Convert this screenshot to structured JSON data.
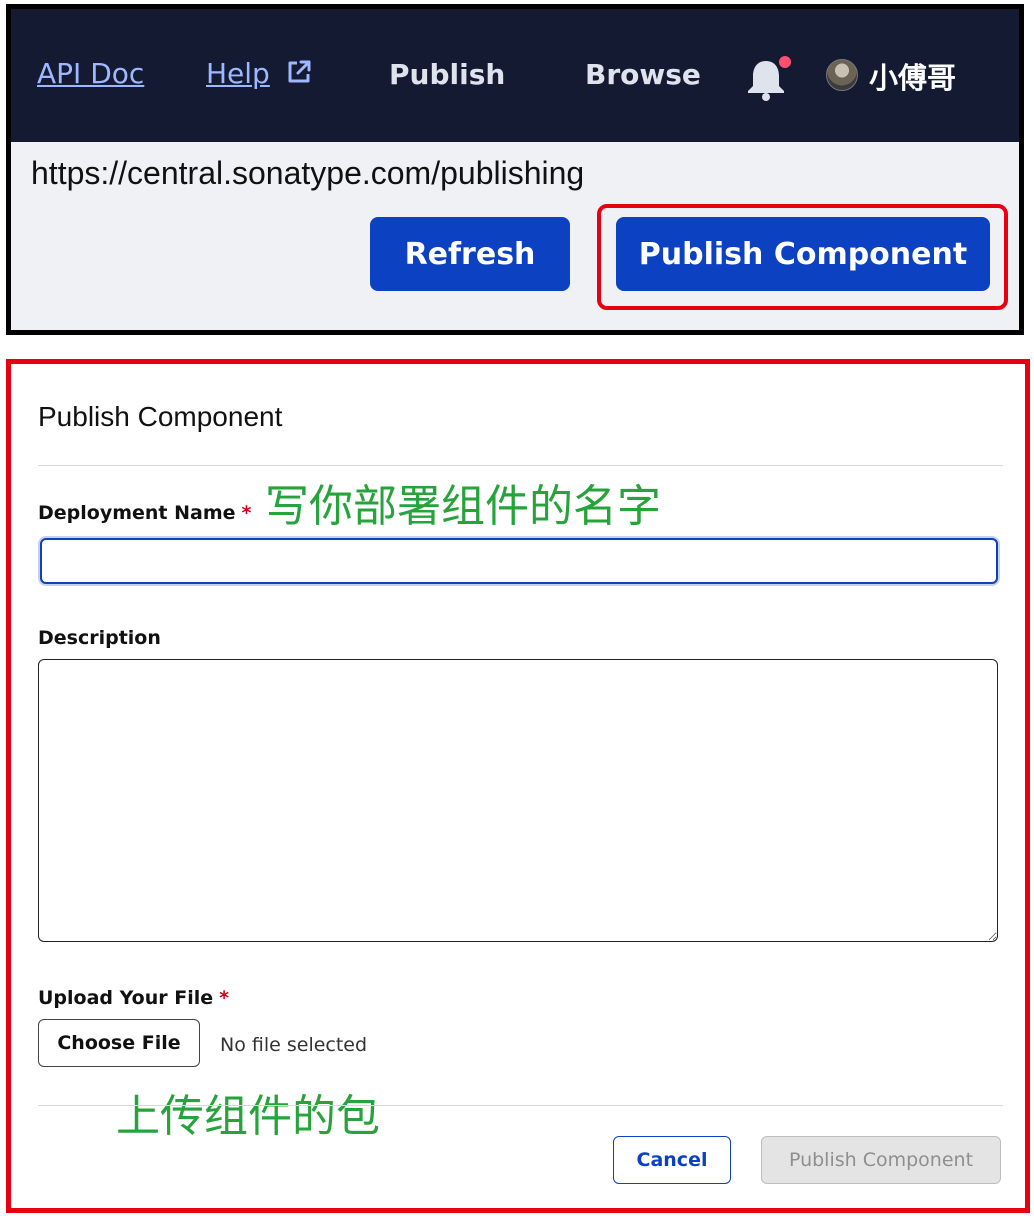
{
  "header": {
    "api_doc": "API Doc",
    "help": "Help",
    "publish": "Publish",
    "browse": "Browse",
    "username": "小傅哥",
    "has_notification": true
  },
  "toolbar": {
    "url": "https://central.sonatype.com/publishing",
    "refresh_label": "Refresh",
    "publish_component_label": "Publish Component"
  },
  "modal": {
    "title": "Publish Component",
    "deployment_name_label": "Deployment Name",
    "deployment_name_value": "",
    "description_label": "Description",
    "description_value": "",
    "upload_label": "Upload Your File",
    "required_mark": "*",
    "choose_file_label": "Choose File",
    "file_status": "No file selected",
    "cancel_label": "Cancel",
    "submit_label": "Publish Component"
  },
  "annotations": {
    "name_hint": "写你部署组件的名字",
    "upload_hint": "上传组件的包"
  },
  "colors": {
    "nav_background": "#141a32",
    "primary_button": "#0c41c1",
    "highlight_border": "#e60012",
    "annotation_text": "#27a33b",
    "notification_dot": "#ff4f6d"
  },
  "icons": [
    "external-link-icon",
    "bell-icon",
    "avatar"
  ]
}
